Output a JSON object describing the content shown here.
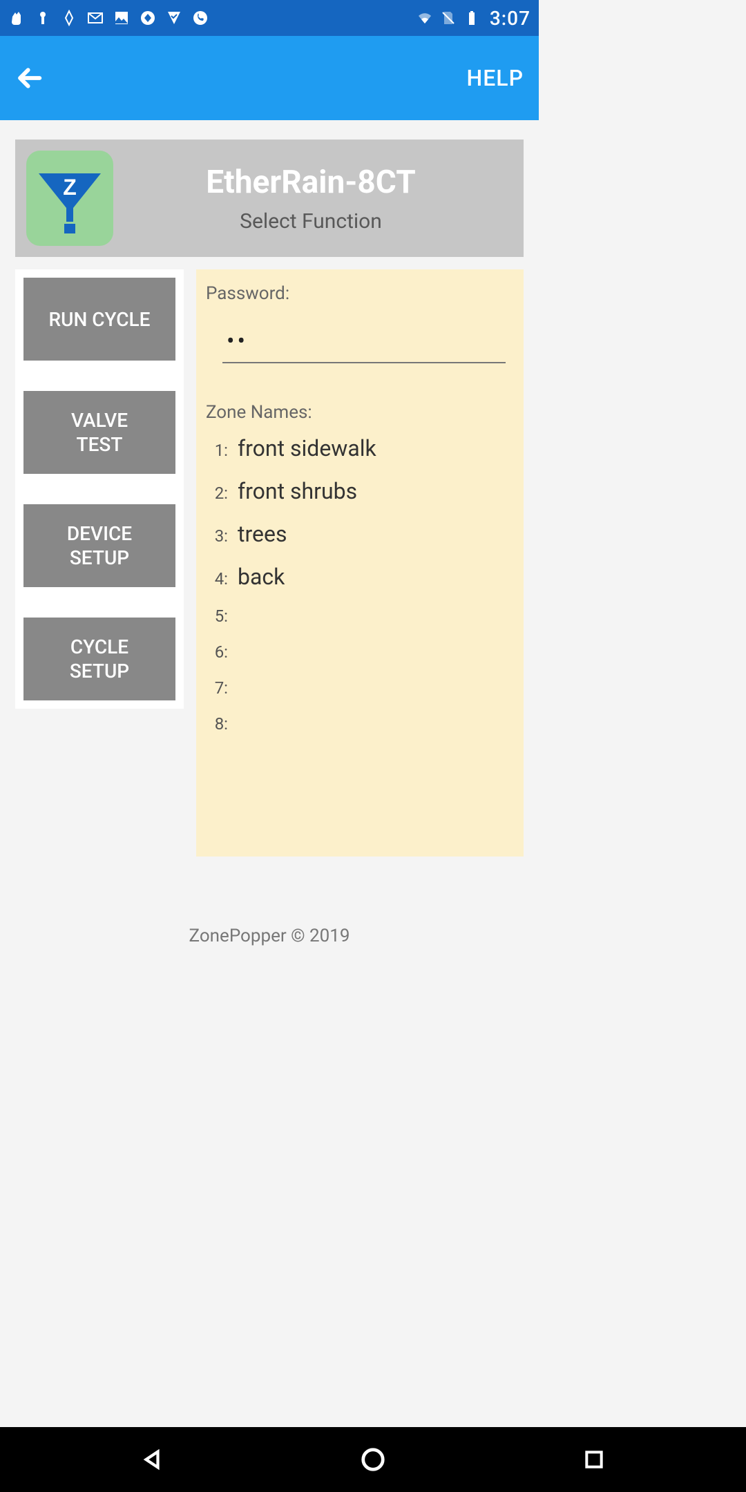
{
  "status": {
    "time": "3:07"
  },
  "appbar": {
    "help": "HELP"
  },
  "device": {
    "title": "EtherRain-8CT",
    "subtitle": "Select Function"
  },
  "menu": {
    "run_cycle": "RUN CYCLE",
    "valve_test": "VALVE\nTEST",
    "device_setup": "DEVICE\nSETUP",
    "cycle_setup": "CYCLE\nSETUP"
  },
  "detail": {
    "password_label": "Password:",
    "password_value": "••",
    "zones_label": "Zone Names:",
    "zones": [
      {
        "num": "1:",
        "name": "front sidewalk"
      },
      {
        "num": "2:",
        "name": "front shrubs"
      },
      {
        "num": "3:",
        "name": "trees"
      },
      {
        "num": "4:",
        "name": "back"
      },
      {
        "num": "5:",
        "name": ""
      },
      {
        "num": "6:",
        "name": ""
      },
      {
        "num": "7:",
        "name": ""
      },
      {
        "num": "8:",
        "name": ""
      }
    ]
  },
  "footer": {
    "text": "ZonePopper © 2019"
  }
}
